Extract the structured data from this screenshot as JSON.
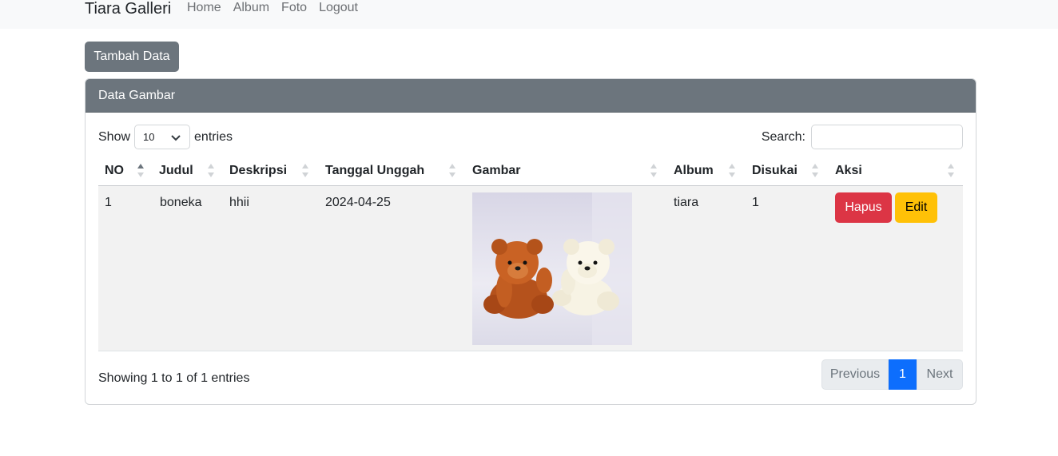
{
  "navbar": {
    "brand": "Tiara Galleri",
    "links": [
      "Home",
      "Album",
      "Foto",
      "Logout"
    ]
  },
  "add_button": "Tambah Data",
  "card": {
    "title": "Data Gambar",
    "length": {
      "show": "Show",
      "value": "10",
      "entries": "entries"
    },
    "search": {
      "label": "Search:",
      "value": ""
    },
    "table": {
      "columns": [
        "NO",
        "Judul",
        "Deskripsi",
        "Tanggal Unggah",
        "Gambar",
        "Album",
        "Disukai",
        "Aksi"
      ],
      "rows": [
        {
          "no": "1",
          "judul": "boneka",
          "deskripsi": "hhii",
          "tanggal": "2024-04-25",
          "album": "tiara",
          "disukai": "1",
          "hapus": "Hapus",
          "edit": "Edit"
        }
      ]
    },
    "info": "Showing 1 to 1 of 1 entries",
    "pager": {
      "previous": "Previous",
      "current": "1",
      "next": "Next"
    }
  },
  "colors": {
    "header": "#6c757d",
    "danger": "#dc3545",
    "warning": "#ffc107",
    "primary": "#0d6efd"
  },
  "icons": [
    "chevron-down-icon",
    "sort-icon",
    "teddy-bears-image"
  ]
}
